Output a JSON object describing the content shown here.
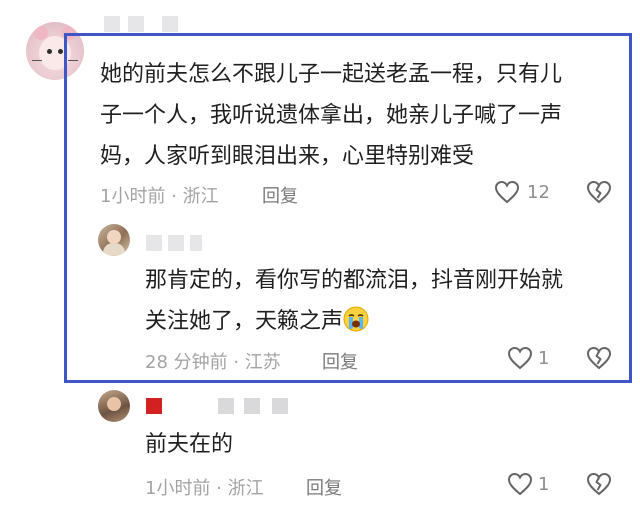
{
  "comments": [
    {
      "lines": [
        "她的前夫怎么不跟儿子一起送老孟一程，只有儿",
        "子一个人，我听说遗体拿出，她亲儿子喊了一声",
        "妈，人家听到眼泪出来，心里特别难受"
      ],
      "meta": "1小时前 · 浙江",
      "reply_label": "回复",
      "likes": "12"
    },
    {
      "lines": [
        "那肯定的，看你写的都流泪，抖音刚开始就",
        "关注她了，天籁之声"
      ],
      "emoji": "crying-face",
      "meta": "28 分钟前 · 江苏",
      "reply_label": "回复",
      "likes": "1"
    },
    {
      "lines": [
        "前夫在的"
      ],
      "meta": "1小时前 · 浙江",
      "reply_label": "回复",
      "likes": "1"
    }
  ],
  "icons": [
    "heart-outline-icon",
    "broken-heart-icon"
  ],
  "colors": {
    "highlight_border": "#3f56c7",
    "meta_text": "#a3a3a3",
    "icon_stroke": "#666666"
  }
}
